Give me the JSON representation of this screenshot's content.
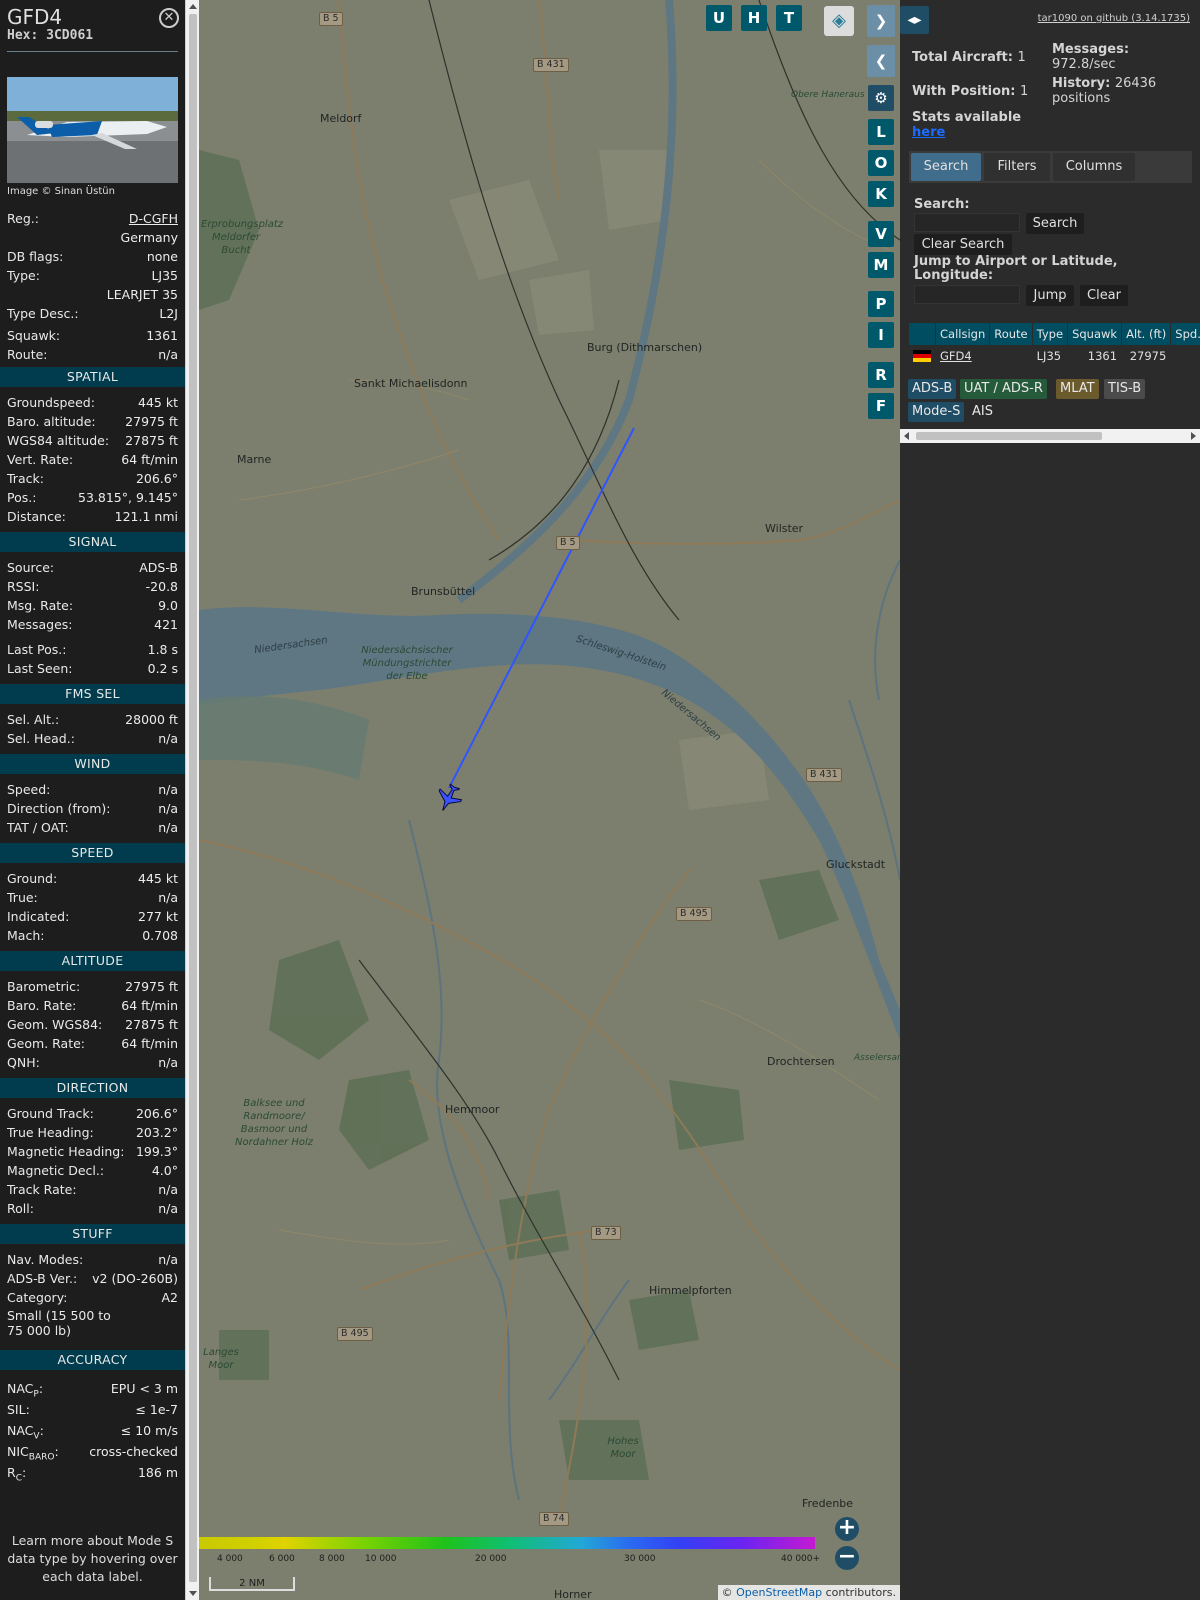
{
  "info": {
    "callsign": "GFD4",
    "hex_label": "Hex:",
    "hex": "3CD061",
    "photo_credit": "Image © Sinan Üstün",
    "rows_top": [
      {
        "label": "Reg.:",
        "value": "D-CGFH"
      },
      {
        "label": "",
        "value": "Germany"
      },
      {
        "label": "DB flags:",
        "value": "none"
      },
      {
        "label": "Type:",
        "value": "LJ35"
      },
      {
        "label": "",
        "value": "LEARJET 35"
      },
      {
        "label": "Type Desc.:",
        "value": "L2J"
      },
      {
        "label": "Squawk:",
        "value": "1361"
      },
      {
        "label": "Route:",
        "value": "n/a"
      }
    ],
    "sections": [
      {
        "title": "SPATIAL",
        "rows": [
          {
            "label": "Groundspeed:",
            "value": "445 kt"
          },
          {
            "label": "Baro. altitude:",
            "value": "27975 ft"
          },
          {
            "label": "WGS84 altitude:",
            "value": "27875 ft"
          },
          {
            "label": "Vert. Rate:",
            "value": "64 ft/min"
          },
          {
            "label": "Track:",
            "value": "206.6°"
          },
          {
            "label": "Pos.:",
            "value": "53.815°, 9.145°"
          },
          {
            "label": "Distance:",
            "value": "121.1 nmi"
          }
        ]
      },
      {
        "title": "SIGNAL",
        "rows": [
          {
            "label": "Source:",
            "value": "ADS-B"
          },
          {
            "label": "RSSI:",
            "value": "-20.8"
          },
          {
            "label": "Msg. Rate:",
            "value": "9.0"
          },
          {
            "label": "Messages:",
            "value": "421"
          },
          {
            "label": "Last Pos.:",
            "value": "1.8 s"
          },
          {
            "label": "Last Seen:",
            "value": "0.2 s"
          }
        ]
      },
      {
        "title": "FMS SEL",
        "rows": [
          {
            "label": "Sel. Alt.:",
            "value": "28000 ft"
          },
          {
            "label": "Sel. Head.:",
            "value": "n/a"
          }
        ]
      },
      {
        "title": "WIND",
        "rows": [
          {
            "label": "Speed:",
            "value": "n/a"
          },
          {
            "label": "Direction (from):",
            "value": "n/a"
          },
          {
            "label": "TAT / OAT:",
            "value": "n/a"
          }
        ]
      },
      {
        "title": "SPEED",
        "rows": [
          {
            "label": "Ground:",
            "value": "445 kt"
          },
          {
            "label": "True:",
            "value": "n/a"
          },
          {
            "label": "Indicated:",
            "value": "277 kt"
          },
          {
            "label": "Mach:",
            "value": "0.708"
          }
        ]
      },
      {
        "title": "ALTITUDE",
        "rows": [
          {
            "label": "Barometric:",
            "value": "27975 ft"
          },
          {
            "label": "Baro. Rate:",
            "value": "64 ft/min"
          },
          {
            "label": "Geom. WGS84:",
            "value": "27875 ft"
          },
          {
            "label": "Geom. Rate:",
            "value": "64 ft/min"
          },
          {
            "label": "QNH:",
            "value": "n/a"
          }
        ]
      },
      {
        "title": "DIRECTION",
        "rows": [
          {
            "label": "Ground Track:",
            "value": "206.6°"
          },
          {
            "label": "True Heading:",
            "value": "203.2°"
          },
          {
            "label": "Magnetic Heading:",
            "value": "199.3°"
          },
          {
            "label": "Magnetic Decl.:",
            "value": "4.0°"
          },
          {
            "label": "Track Rate:",
            "value": "n/a"
          },
          {
            "label": "Roll:",
            "value": "n/a"
          }
        ]
      },
      {
        "title": "STUFF",
        "rows": [
          {
            "label": "Nav. Modes:",
            "value": "n/a"
          },
          {
            "label": "ADS-B Ver.:",
            "value": "v2 (DO-260B)"
          },
          {
            "label": "Category:",
            "value": "A2"
          }
        ]
      },
      {
        "title": "ACCURACY",
        "rows": []
      }
    ],
    "category_desc": "Small (15 500 to 75 000 lb)",
    "accuracy": [
      {
        "label": "NAC",
        "sub": "P",
        "value": "EPU < 3 m"
      },
      {
        "label": "SIL:",
        "sub": "",
        "value": "≤ 1e-7"
      },
      {
        "label": "NAC",
        "sub": "V",
        "value": "≤ 10 m/s"
      },
      {
        "label": "NIC",
        "sub": "BARO",
        "value": "cross-checked"
      },
      {
        "label": "R",
        "sub": "C",
        "value": "186 m"
      }
    ],
    "footer": "Learn more about Mode S data type by hovering over each data label."
  },
  "map": {
    "buttons": [
      "U",
      "H",
      "T"
    ],
    "side_buttons": [
      "L",
      "O",
      "K",
      "V",
      "M",
      "P",
      "I",
      "R",
      "F"
    ],
    "places": [
      {
        "name": "Meldorf"
      },
      {
        "name": "Burg (Dithmarschen)"
      },
      {
        "name": "Sankt Michaelisdonn"
      },
      {
        "name": "Marne"
      },
      {
        "name": "Wilster"
      },
      {
        "name": "Brunsbüttel"
      },
      {
        "name": "Gluckstadt"
      },
      {
        "name": "Drochtersen"
      },
      {
        "name": "Hemmoor"
      },
      {
        "name": "Himmelpforten"
      },
      {
        "name": "Fredenbe"
      },
      {
        "name": "Obere Haneraus"
      },
      {
        "name": "Asselersand"
      },
      {
        "name": "Horner"
      }
    ],
    "nature": [
      {
        "name": "Erprobungsplatz Meldorfer Bucht"
      },
      {
        "name": "Niedersächsischer Mündungstrichter der Elbe"
      },
      {
        "name": "Balksee und Randmoore/ Basmoor und Nordahner Holz"
      },
      {
        "name": "Langes Moor"
      },
      {
        "name": "Hohes Moor"
      }
    ],
    "water_labels": [
      "Niedersachsen",
      "Schleswig-Holstein",
      "Niedersachsen"
    ],
    "roads": [
      "B 5",
      "B 431",
      "B 5",
      "B 431",
      "B 495",
      "B 73",
      "B 495",
      "B 74"
    ],
    "altitude_legend": [
      "4 000",
      "6 000",
      "8 000",
      "10 000",
      "20 000",
      "30 000",
      "40 000+"
    ],
    "scale": "2 NM",
    "attribution_prefix": "© ",
    "attribution_link": "OpenStreetMap",
    "attribution_suffix": " contributors."
  },
  "right": {
    "github": "tar1090 on github (3.14.1735)",
    "total_aircraft_label": "Total Aircraft:",
    "total_aircraft": "1",
    "with_position_label": "With Position:",
    "with_position": "1",
    "stats_label": "Stats available",
    "stats_link": "here",
    "messages_label": "Messages:",
    "messages": "972.8/sec",
    "history_label": "History:",
    "history": "26436 positions",
    "tabs": [
      "Search",
      "Filters",
      "Columns"
    ],
    "search_label": "Search:",
    "search_value": "",
    "search_button": "Search",
    "clear_search_button": "Clear Search",
    "jump_label": "Jump to Airport or Latitude, Longitude:",
    "jump_value": "",
    "jump_button": "Jump",
    "clear_button": "Clear",
    "table": {
      "headers": [
        "",
        "Callsign",
        "Route",
        "Type",
        "Squawk",
        "Alt. (ft)",
        "Spd."
      ],
      "rows": [
        {
          "callsign": "GFD4",
          "route": "",
          "type": "LJ35",
          "squawk": "1361",
          "alt": "27975",
          "spd": ""
        }
      ]
    },
    "source_chips": [
      "ADS-B",
      "UAT / ADS-R",
      "MLAT",
      "TIS-B",
      "Mode-S",
      "AIS"
    ],
    "colors": {
      "accent": "#004d61",
      "adsb": "#1f4d66",
      "uat": "#255b3a",
      "mlat": "#6b5a2c",
      "tisb": "#4b4b4b",
      "modes": "#1f4d66"
    }
  }
}
